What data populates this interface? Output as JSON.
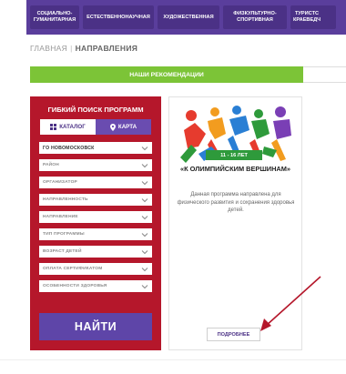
{
  "nav": {
    "items": [
      {
        "label": "СОЦИАЛЬНО-\nГУМАНИТАРНАЯ"
      },
      {
        "label": "ЕСТЕСТВЕННОНАУЧНАЯ"
      },
      {
        "label": "ХУДОЖЕСТВЕННАЯ"
      },
      {
        "label": "ФИЗКУЛЬТУРНО-\nСПОРТИВНАЯ"
      },
      {
        "label": "ТУРИСТС\nКРАЕВЕДЧ"
      }
    ]
  },
  "breadcrumb": {
    "home": "ГЛАВНАЯ",
    "separator": "|",
    "current": "НАПРАВЛЕНИЯ"
  },
  "recommendations": {
    "label": "НАШИ РЕКОМЕНДАЦИИ"
  },
  "search": {
    "title": "ГИБКИЙ ПОИСК ПРОГРАММ",
    "tab_catalog": "КАТАЛОГ",
    "tab_map": "КАРТА",
    "filters": [
      {
        "label": "ГО НОВОМОСКОВСК",
        "filled": true
      },
      {
        "label": "РАЙОН",
        "filled": false
      },
      {
        "label": "ОРГАНИЗАТОР",
        "filled": false
      },
      {
        "label": "НАПРАВЛЕННОСТЬ",
        "filled": false
      },
      {
        "label": "НАПРАВЛЕНИЕ",
        "filled": false
      },
      {
        "label": "ТИП ПРОГРАММЫ",
        "filled": false
      },
      {
        "label": "ВОЗРАСТ ДЕТЕЙ",
        "filled": false
      },
      {
        "label": "ОПЛАТА СЕРТИФИКАТОМ",
        "filled": false
      },
      {
        "label": "ОСОБЕННОСТИ ЗДОРОВЬЯ",
        "filled": false
      }
    ],
    "find_label": "НАЙТИ"
  },
  "card": {
    "age_badge": "11 - 16 ЛЕТ",
    "title": "«К ОЛИМПИЙСКИМ ВЕРШИНАМ»",
    "description": "Данная программа направлена для физического развития и сохранения здоровья детей.",
    "more_label": "ПОДРОБНЕЕ"
  },
  "colors": {
    "nav_bg": "#5a3e9c",
    "panel_bg": "#b5172b",
    "rec_green": "#7cc437",
    "find_btn": "#5e45a8",
    "badge_green": "#2e9a3b",
    "arrow": "#b5172b"
  }
}
